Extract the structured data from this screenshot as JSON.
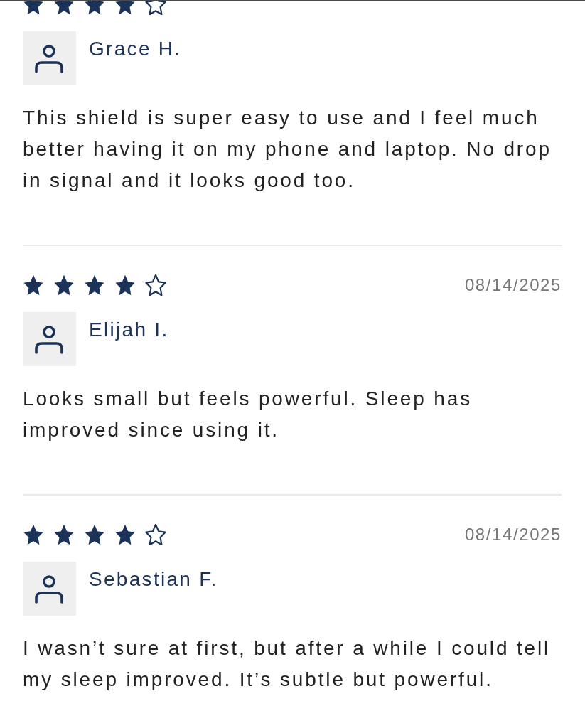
{
  "reviews": [
    {
      "stars": 4,
      "author": "Grace H.",
      "text": "This shield is super easy to use and I feel much better having it on my phone and laptop. No drop in signal and it looks good too."
    },
    {
      "stars": 4,
      "date": "08/14/2025",
      "author": "Elijah I.",
      "text": "Looks small but feels powerful. Sleep has improved since using it."
    },
    {
      "stars": 4,
      "date": "08/14/2025",
      "author": "Sebastian F.",
      "text": "I wasn’t sure at first, but after a while I could tell my sleep improved. It’s subtle but powerful."
    }
  ]
}
